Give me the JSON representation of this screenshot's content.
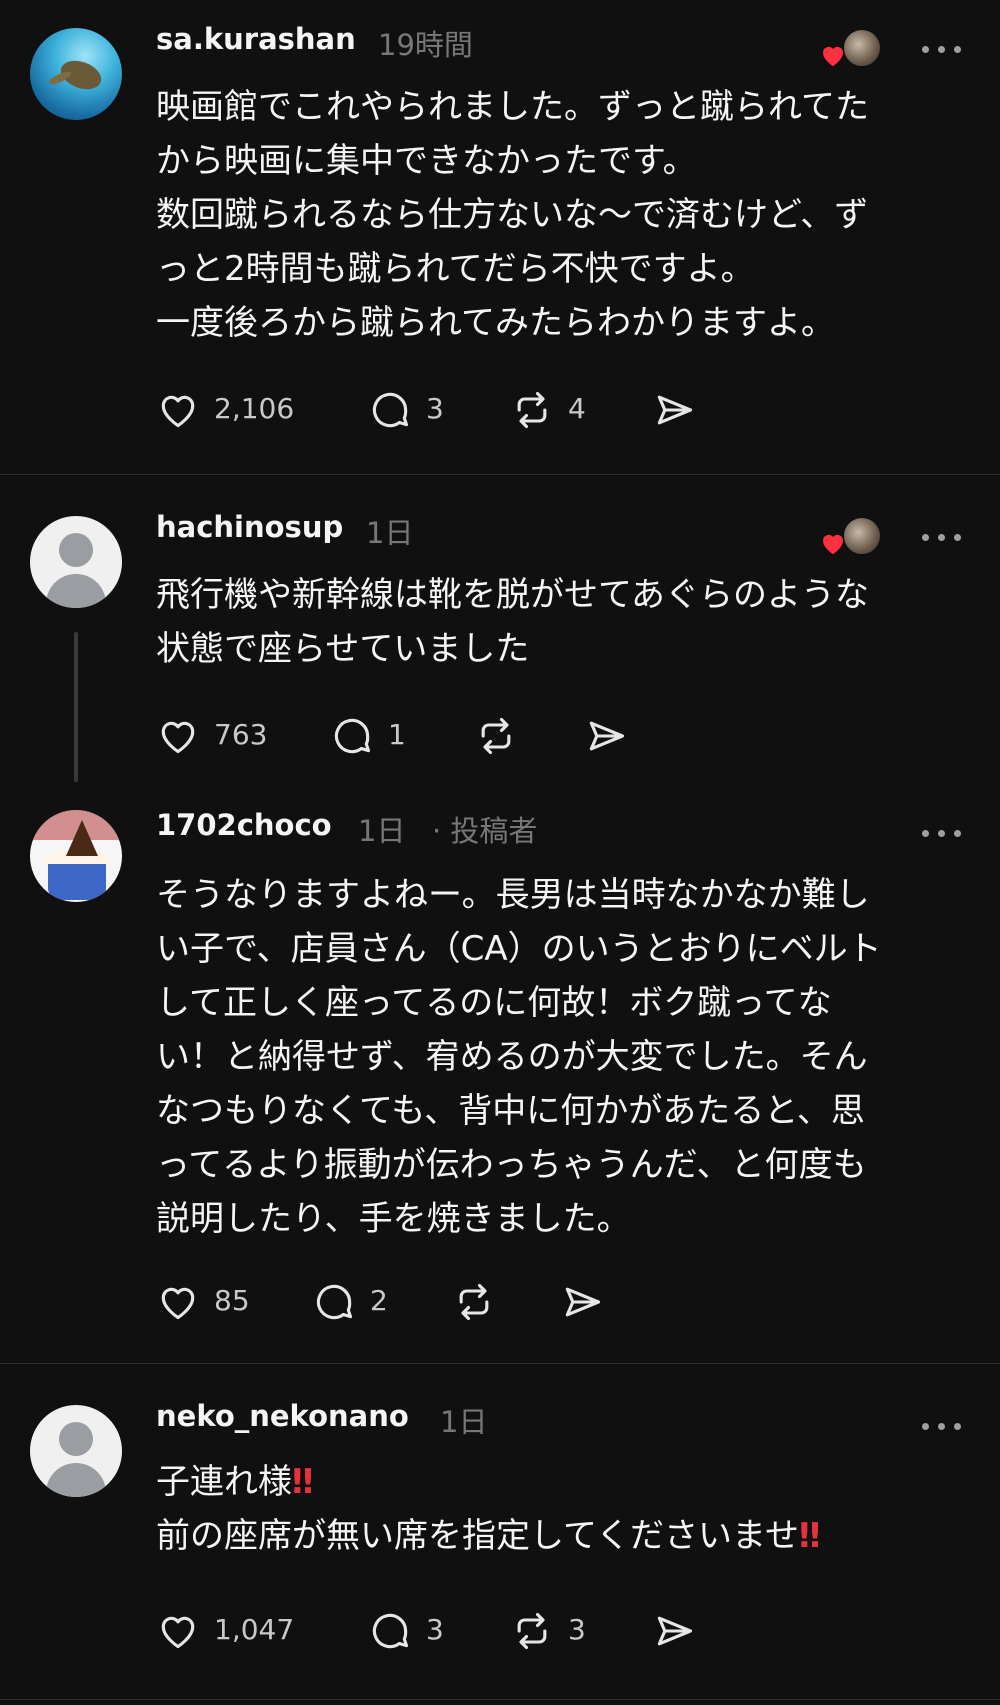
{
  "posts": [
    {
      "username": "sa.kurashan",
      "time": "19時間",
      "lines": [
        "映画館でこれやられました。ずっと蹴られてた",
        "から映画に集中できなかったです。",
        "数回蹴られるなら仕方ないな〜で済むけど、ず",
        "っと2時間も蹴られてだら不快ですよ。",
        "一度後ろから蹴られてみたらわかりますよ。"
      ],
      "likes": "2,106",
      "replies": "3",
      "reposts": "4",
      "avatar": "sea-turtle-photo",
      "liked_by_author": true
    },
    {
      "username": "hachinosup",
      "time": "1日",
      "lines": [
        "飛行機や新幹線は靴を脱がせてあぐらのような",
        "状態で座らせていました"
      ],
      "likes": "763",
      "replies": "1",
      "reposts": "",
      "avatar": "default-avatar",
      "liked_by_author": true
    },
    {
      "username": "1702choco",
      "time": "1日",
      "author_tag": "· 投稿者",
      "lines": [
        "そうなりますよねー。長男は当時なかなか難し",
        "い子で、店員さん（CA）のいうとおりにベルト",
        "して正しく座ってるのに何故！ボク蹴ってな",
        "い！と納得せず、宥めるのが大変でした。そん",
        "なつもりなくても、背中に何かがあたると、思",
        "ってるより振動が伝わっちゃうんだ、と何度も",
        "説明したり、手を焼きました。"
      ],
      "likes": "85",
      "replies": "2",
      "reposts": "",
      "avatar": "chocolate-sundae-photo",
      "liked_by_author": false
    },
    {
      "username": "neko_nekonano",
      "time": "1日",
      "line1_text": "子連れ様",
      "line2_text": "前の座席が無い席を指定してくださいませ",
      "bang": "‼",
      "likes": "1,047",
      "replies": "3",
      "reposts": "3",
      "avatar": "default-avatar",
      "liked_by_author": false
    }
  ],
  "icons": {
    "like": "heart-outline-icon",
    "reply": "speech-bubble-icon",
    "repost": "repost-arrows-icon",
    "share": "send-arrow-icon",
    "more": "ellipsis-icon",
    "liked_badge": "red-heart-icon"
  },
  "colors": {
    "background": "#101010",
    "text": "#f3f5f7",
    "muted": "#77777a",
    "divider": "#2d2d2d",
    "heart": "#ff3040"
  }
}
